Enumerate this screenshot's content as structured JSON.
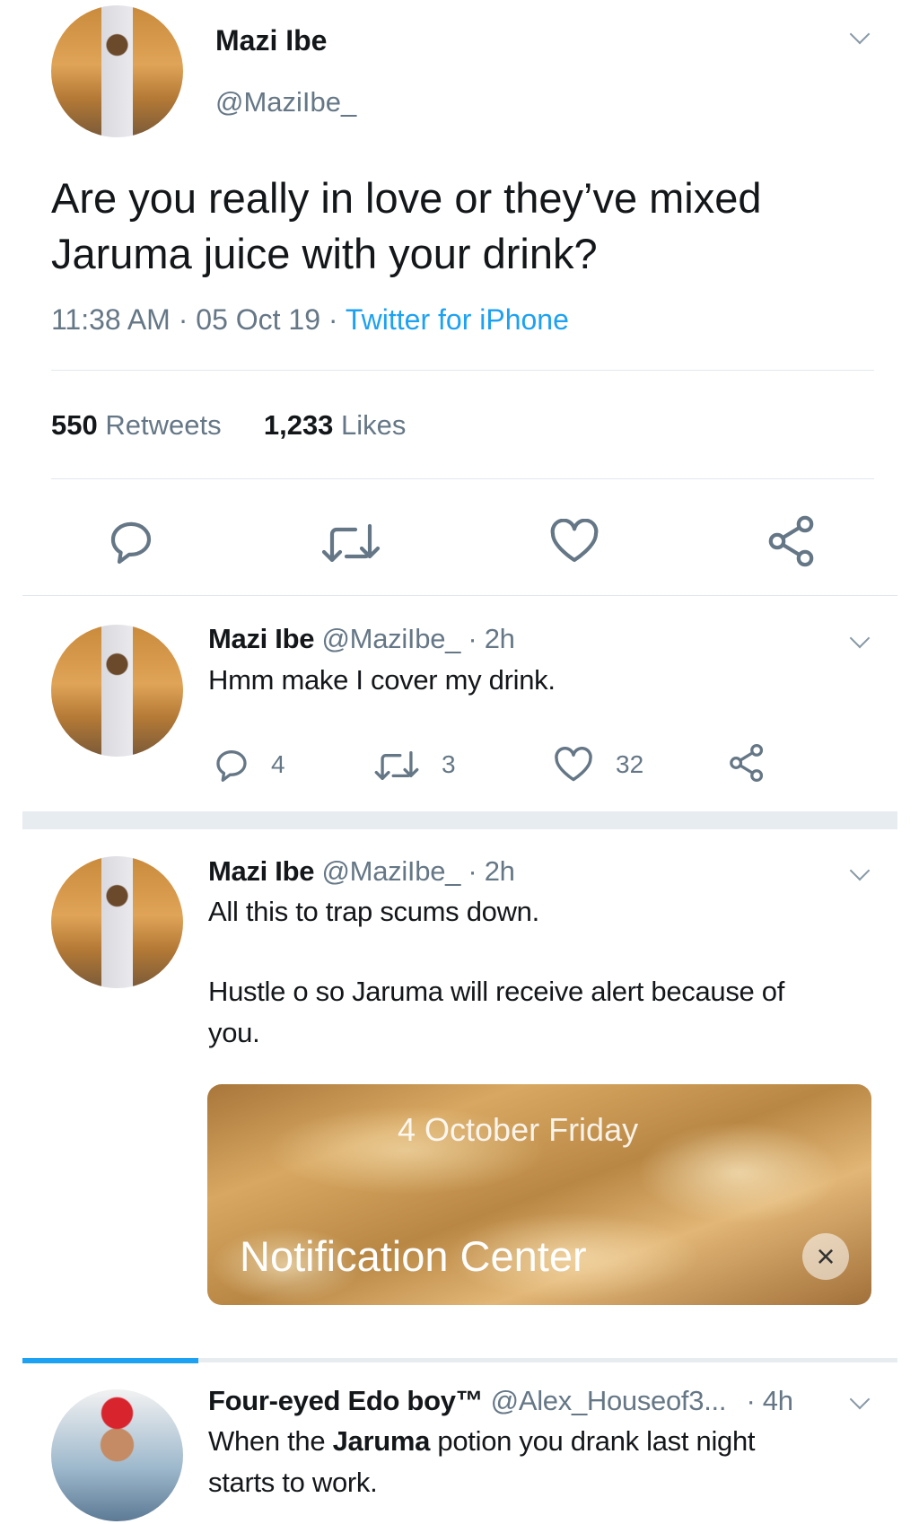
{
  "main_tweet": {
    "display_name": "Mazi Ibe",
    "handle": "@MaziIbe_",
    "text_line1": "Are you really in love or they’ve mixed",
    "text_line2": "Jaruma juice with your drink?",
    "time": "11:38 AM",
    "date": "05 Oct 19",
    "source": "Twitter for iPhone",
    "retweets_count": "550",
    "retweets_label": "Retweets",
    "likes_count": "1,233",
    "likes_label": "Likes"
  },
  "replies": [
    {
      "display_name": "Mazi Ibe",
      "handle": "@MaziIbe_",
      "age": "· 2h",
      "text": "Hmm make I cover my drink.",
      "reply_count": "4",
      "retweet_count": "3",
      "like_count": "32"
    },
    {
      "display_name": "Mazi Ibe",
      "handle": "@MaziIbe_",
      "age": "· 2h",
      "text_line1": "All this to trap scums down.",
      "text_line2": "Hustle o so Jaruma will receive alert because of",
      "text_line3": "you.",
      "media_date": "4 October Friday",
      "media_title": "Notification Center",
      "media_close": "×"
    },
    {
      "display_name": "Four-eyed Edo boy™",
      "handle": "@Alex_Houseof3...",
      "age": "· 4h",
      "text_before": "When the ",
      "text_bold": "Jaruma",
      "text_after": " potion you drank last night",
      "text_line2": "starts to work."
    }
  ],
  "colors": {
    "accent": "#1da1f2",
    "secondary_text": "#657786",
    "icon": "#657786",
    "divider": "#e1e8ed"
  },
  "icons": [
    "reply-icon",
    "retweet-icon",
    "like-icon",
    "share-icon",
    "chevron-down-icon"
  ]
}
